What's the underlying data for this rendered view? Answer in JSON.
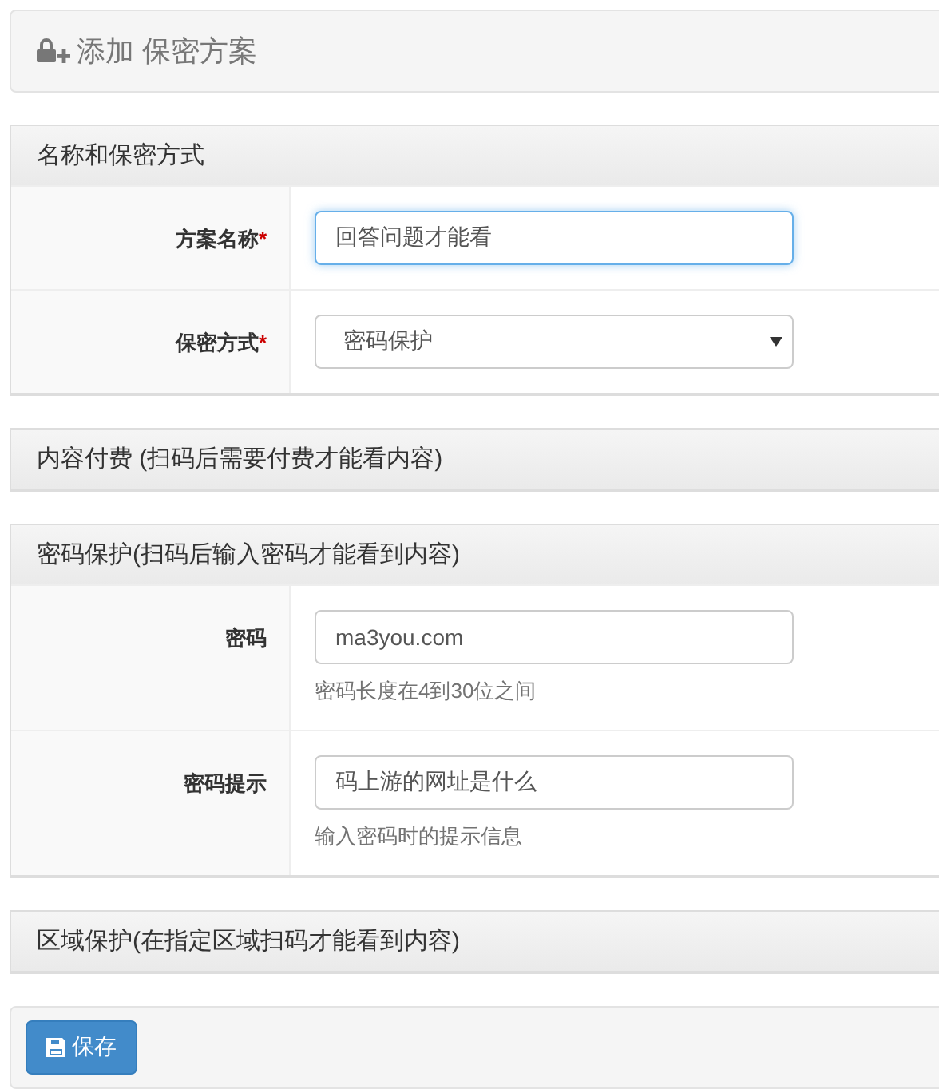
{
  "page_title": "添加 保密方案",
  "sections": [
    {
      "title": "名称和保密方式",
      "fields": [
        {
          "kind": "input",
          "label": "方案名称",
          "required_mark": "*",
          "value": "回答问题才能看",
          "focused": true
        },
        {
          "kind": "select",
          "label": "保密方式",
          "required_mark": "*",
          "value": "密码保护"
        }
      ]
    },
    {
      "title": "内容付费 (扫码后需要付费才能看内容)"
    },
    {
      "title": "密码保护(扫码后输入密码才能看到内容)",
      "fields": [
        {
          "kind": "input",
          "label": "密码",
          "value": "ma3you.com",
          "focused": false,
          "help": "密码长度在4到30位之间"
        },
        {
          "kind": "input",
          "label": "密码提示",
          "value": "码上游的网址是什么",
          "focused": false,
          "help": "输入密码时的提示信息"
        }
      ]
    },
    {
      "title": "区域保护(在指定区域扫码才能看到内容)"
    }
  ],
  "save_button": "保存"
}
